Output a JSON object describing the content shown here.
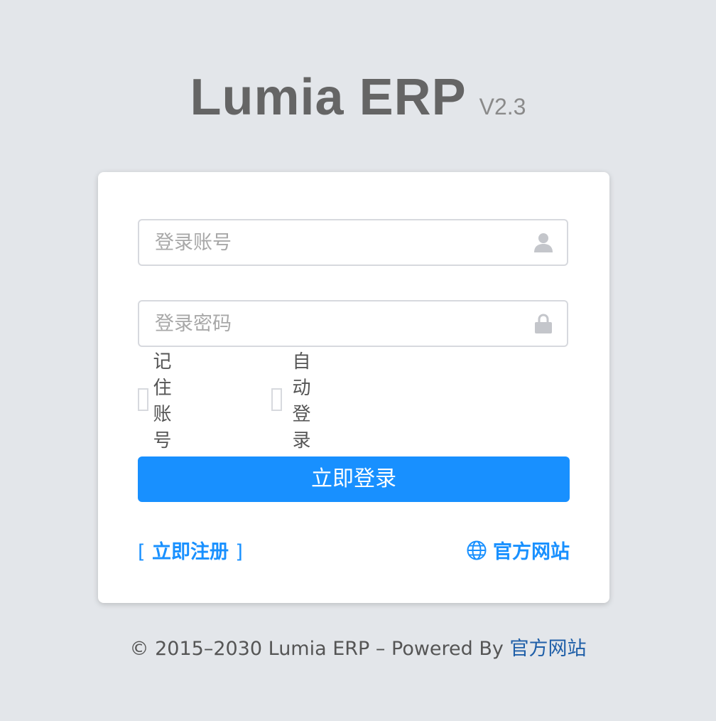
{
  "brand": {
    "name": "Lumia ERP",
    "version": "V2.3"
  },
  "login": {
    "account_placeholder": "登录账号",
    "password_placeholder": "登录密码",
    "remember_account_label": "记住账号",
    "auto_login_label": "自动登录",
    "submit_label": "立即登录",
    "register_label": "立即注册",
    "register_bracket_open": "[",
    "register_bracket_close": "]",
    "site_label": "官方网站"
  },
  "icons": {
    "account": "user-icon",
    "password": "lock-icon",
    "site": "globe-icon"
  },
  "colors": {
    "background": "#e3e6ea",
    "accent": "#1890ff",
    "footer_link": "#1f5fa8"
  },
  "footer": {
    "copyright_text": "© 2015–2030 Lumia ERP – Powered By ",
    "link_label": "官方网站"
  }
}
